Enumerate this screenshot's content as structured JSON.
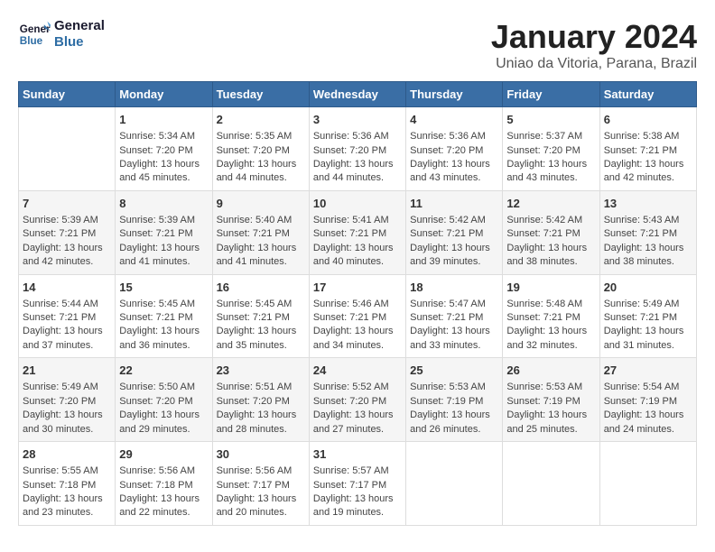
{
  "header": {
    "logo_text_general": "General",
    "logo_text_blue": "Blue",
    "title": "January 2024",
    "subtitle": "Uniao da Vitoria, Parana, Brazil"
  },
  "weekdays": [
    "Sunday",
    "Monday",
    "Tuesday",
    "Wednesday",
    "Thursday",
    "Friday",
    "Saturday"
  ],
  "weeks": [
    [
      {
        "day": "",
        "info": ""
      },
      {
        "day": "1",
        "info": "Sunrise: 5:34 AM\nSunset: 7:20 PM\nDaylight: 13 hours\nand 45 minutes."
      },
      {
        "day": "2",
        "info": "Sunrise: 5:35 AM\nSunset: 7:20 PM\nDaylight: 13 hours\nand 44 minutes."
      },
      {
        "day": "3",
        "info": "Sunrise: 5:36 AM\nSunset: 7:20 PM\nDaylight: 13 hours\nand 44 minutes."
      },
      {
        "day": "4",
        "info": "Sunrise: 5:36 AM\nSunset: 7:20 PM\nDaylight: 13 hours\nand 43 minutes."
      },
      {
        "day": "5",
        "info": "Sunrise: 5:37 AM\nSunset: 7:20 PM\nDaylight: 13 hours\nand 43 minutes."
      },
      {
        "day": "6",
        "info": "Sunrise: 5:38 AM\nSunset: 7:21 PM\nDaylight: 13 hours\nand 42 minutes."
      }
    ],
    [
      {
        "day": "7",
        "info": "Sunrise: 5:39 AM\nSunset: 7:21 PM\nDaylight: 13 hours\nand 42 minutes."
      },
      {
        "day": "8",
        "info": "Sunrise: 5:39 AM\nSunset: 7:21 PM\nDaylight: 13 hours\nand 41 minutes."
      },
      {
        "day": "9",
        "info": "Sunrise: 5:40 AM\nSunset: 7:21 PM\nDaylight: 13 hours\nand 41 minutes."
      },
      {
        "day": "10",
        "info": "Sunrise: 5:41 AM\nSunset: 7:21 PM\nDaylight: 13 hours\nand 40 minutes."
      },
      {
        "day": "11",
        "info": "Sunrise: 5:42 AM\nSunset: 7:21 PM\nDaylight: 13 hours\nand 39 minutes."
      },
      {
        "day": "12",
        "info": "Sunrise: 5:42 AM\nSunset: 7:21 PM\nDaylight: 13 hours\nand 38 minutes."
      },
      {
        "day": "13",
        "info": "Sunrise: 5:43 AM\nSunset: 7:21 PM\nDaylight: 13 hours\nand 38 minutes."
      }
    ],
    [
      {
        "day": "14",
        "info": "Sunrise: 5:44 AM\nSunset: 7:21 PM\nDaylight: 13 hours\nand 37 minutes."
      },
      {
        "day": "15",
        "info": "Sunrise: 5:45 AM\nSunset: 7:21 PM\nDaylight: 13 hours\nand 36 minutes."
      },
      {
        "day": "16",
        "info": "Sunrise: 5:45 AM\nSunset: 7:21 PM\nDaylight: 13 hours\nand 35 minutes."
      },
      {
        "day": "17",
        "info": "Sunrise: 5:46 AM\nSunset: 7:21 PM\nDaylight: 13 hours\nand 34 minutes."
      },
      {
        "day": "18",
        "info": "Sunrise: 5:47 AM\nSunset: 7:21 PM\nDaylight: 13 hours\nand 33 minutes."
      },
      {
        "day": "19",
        "info": "Sunrise: 5:48 AM\nSunset: 7:21 PM\nDaylight: 13 hours\nand 32 minutes."
      },
      {
        "day": "20",
        "info": "Sunrise: 5:49 AM\nSunset: 7:21 PM\nDaylight: 13 hours\nand 31 minutes."
      }
    ],
    [
      {
        "day": "21",
        "info": "Sunrise: 5:49 AM\nSunset: 7:20 PM\nDaylight: 13 hours\nand 30 minutes."
      },
      {
        "day": "22",
        "info": "Sunrise: 5:50 AM\nSunset: 7:20 PM\nDaylight: 13 hours\nand 29 minutes."
      },
      {
        "day": "23",
        "info": "Sunrise: 5:51 AM\nSunset: 7:20 PM\nDaylight: 13 hours\nand 28 minutes."
      },
      {
        "day": "24",
        "info": "Sunrise: 5:52 AM\nSunset: 7:20 PM\nDaylight: 13 hours\nand 27 minutes."
      },
      {
        "day": "25",
        "info": "Sunrise: 5:53 AM\nSunset: 7:19 PM\nDaylight: 13 hours\nand 26 minutes."
      },
      {
        "day": "26",
        "info": "Sunrise: 5:53 AM\nSunset: 7:19 PM\nDaylight: 13 hours\nand 25 minutes."
      },
      {
        "day": "27",
        "info": "Sunrise: 5:54 AM\nSunset: 7:19 PM\nDaylight: 13 hours\nand 24 minutes."
      }
    ],
    [
      {
        "day": "28",
        "info": "Sunrise: 5:55 AM\nSunset: 7:18 PM\nDaylight: 13 hours\nand 23 minutes."
      },
      {
        "day": "29",
        "info": "Sunrise: 5:56 AM\nSunset: 7:18 PM\nDaylight: 13 hours\nand 22 minutes."
      },
      {
        "day": "30",
        "info": "Sunrise: 5:56 AM\nSunset: 7:17 PM\nDaylight: 13 hours\nand 20 minutes."
      },
      {
        "day": "31",
        "info": "Sunrise: 5:57 AM\nSunset: 7:17 PM\nDaylight: 13 hours\nand 19 minutes."
      },
      {
        "day": "",
        "info": ""
      },
      {
        "day": "",
        "info": ""
      },
      {
        "day": "",
        "info": ""
      }
    ]
  ]
}
